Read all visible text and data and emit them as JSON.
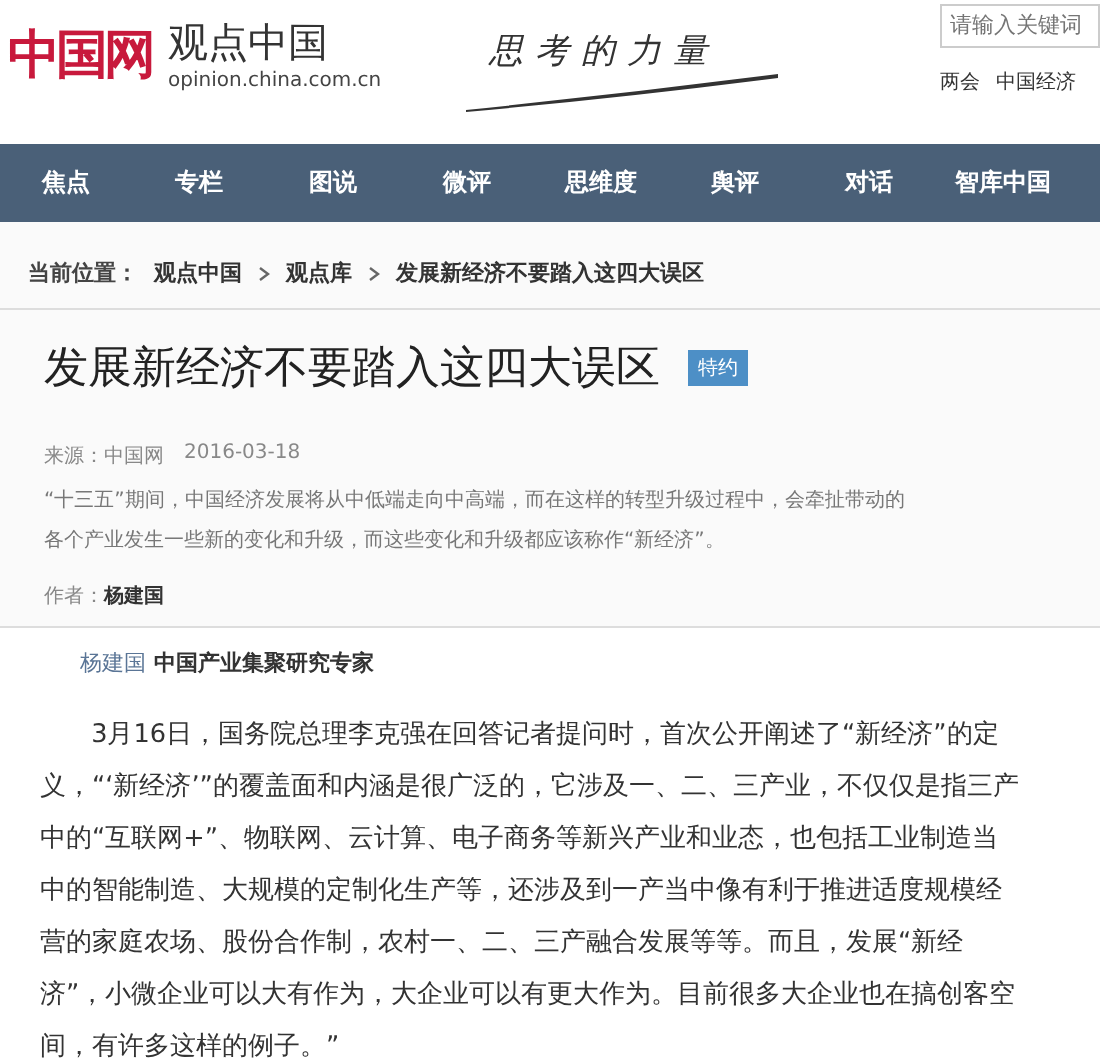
{
  "header": {
    "logo_mark": "中国网",
    "site_name": "观点中国",
    "domain": "opinion.china.com.cn",
    "slogan": "思考的力量",
    "search": {
      "placeholder": "请输入关键词"
    },
    "quick_links": [
      "两会",
      "中国经济"
    ]
  },
  "nav": [
    {
      "label": "焦点"
    },
    {
      "label": "专栏"
    },
    {
      "label": "图说"
    },
    {
      "label": "微评"
    },
    {
      "label": "思维度"
    },
    {
      "label": "舆评"
    },
    {
      "label": "对话"
    },
    {
      "label": "智库中国"
    }
  ],
  "breadcrumb": {
    "label": "当前位置：",
    "items": [
      "观点中国",
      "观点库",
      "发展新经济不要踏入这四大误区"
    ]
  },
  "article": {
    "title": "发展新经济不要踏入这四大误区",
    "badge": "特约",
    "source": "来源：中国网",
    "date": "2016-03-18",
    "summary": "“十三五”期间，中国经济发展将从中低端走向中高端，而在这样的转型升级过程中，会牵扯带动的各个产业发生一些新的变化和升级，而这些变化和升级都应该称作“新经济”。",
    "author_label": "作者：",
    "author": "杨建国"
  },
  "body": {
    "author_name": "杨建国",
    "author_title": "中国产业集聚研究专家",
    "paragraph": "3月16日，国务院总理李克强在回答记者提问时，首次公开阐述了“新经济”的定义，“‘新经济’”的覆盖面和内涵是很广泛的，它涉及一、二、三产业，不仅仅是指三产中的“互联网+”、物联网、云计算、电子商务等新兴产业和业态，也包括工业制造当中的智能制造、大规模的定制化生产等，还涉及到一产当中像有利于推进适度规模经营的家庭农场、股份合作制，农村一、二、三产融合发展等等。而且，发展“新经济”，小微企业可以大有作为，大企业可以有更大作为。目前很多大企业也在搞创客空间，有许多这样的例子。”"
  }
}
